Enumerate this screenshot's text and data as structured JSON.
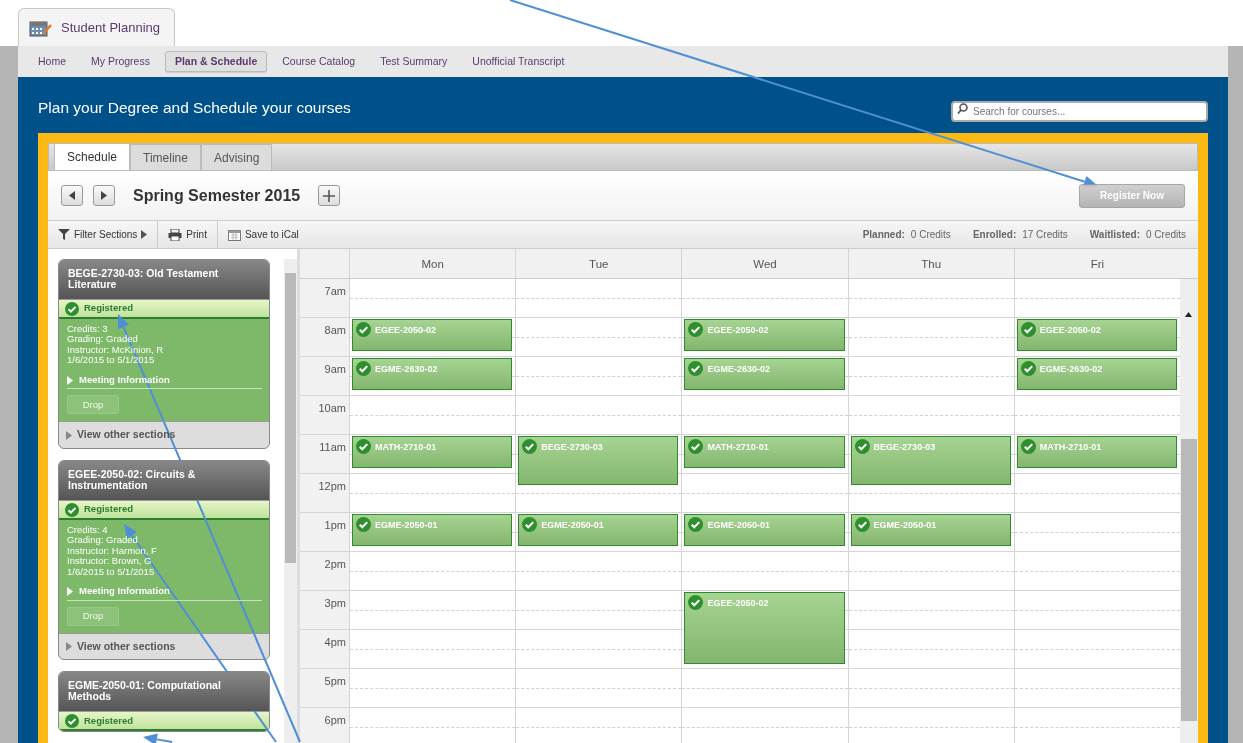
{
  "app_tab": {
    "label": "Student Planning"
  },
  "nav": [
    {
      "label": "Home",
      "selected": false
    },
    {
      "label": "My Progress",
      "selected": false
    },
    {
      "label": "Plan & Schedule",
      "selected": true
    },
    {
      "label": "Course Catalog",
      "selected": false
    },
    {
      "label": "Test Summary",
      "selected": false
    },
    {
      "label": "Unofficial Transcript",
      "selected": false
    }
  ],
  "header": {
    "title": "Plan your Degree and Schedule your courses",
    "search": {
      "placeholder": "Search for courses..."
    }
  },
  "view_tabs": [
    {
      "label": "Schedule",
      "selected": true
    },
    {
      "label": "Timeline",
      "selected": false
    },
    {
      "label": "Advising",
      "selected": false
    }
  ],
  "term": {
    "title": "Spring Semester 2015",
    "register_button": {
      "label": "Register Now",
      "disabled": true
    }
  },
  "toolbar": {
    "filter": "Filter Sections",
    "print": "Print",
    "ical": "Save to iCal"
  },
  "credits": [
    {
      "label": "Planned:",
      "value": "0 Credits"
    },
    {
      "label": "Enrolled:",
      "value": "17 Credits"
    },
    {
      "label": "Waitlisted:",
      "value": "0 Credits"
    }
  ],
  "sections": [
    {
      "title": "BEGE-2730-03: Old Testament Literature",
      "status": "Registered",
      "details": [
        "Credits: 3",
        "Grading: Graded",
        "Instructor: McKinion, R",
        "1/6/2015 to 5/1/2015"
      ],
      "meeting": "Meeting Information",
      "drop": {
        "label": "Drop",
        "disabled": true
      },
      "other": "View other sections"
    },
    {
      "title": "EGEE-2050-02: Circuits & Instrumentation",
      "status": "Registered",
      "details": [
        "Credits: 4",
        "Grading: Graded",
        "Instructor: Harmon, F",
        "Instructor: Brown, G",
        "1/6/2015 to 5/1/2015"
      ],
      "meeting": "Meeting Information",
      "drop": {
        "label": "Drop",
        "disabled": true
      },
      "other": "View other sections"
    },
    {
      "title": "EGME-2050-01: Computational Methods",
      "status": "Registered"
    }
  ],
  "calendar": {
    "days": [
      "Mon",
      "Tue",
      "Wed",
      "Thu",
      "Fri"
    ],
    "rows": [
      {
        "time": "7am",
        "cells": [
          null,
          null,
          null,
          null,
          null
        ]
      },
      {
        "time": "8am",
        "cells": [
          {
            "code": "EGEE-2050-02",
            "kind": "short",
            "registered": true
          },
          null,
          {
            "code": "EGEE-2050-02",
            "kind": "short",
            "registered": true
          },
          null,
          {
            "code": "EGEE-2050-02",
            "kind": "short",
            "registered": true
          }
        ]
      },
      {
        "time": "9am",
        "cells": [
          {
            "code": "EGME-2630-02",
            "kind": "short",
            "registered": true
          },
          null,
          {
            "code": "EGME-2630-02",
            "kind": "short",
            "registered": true
          },
          null,
          {
            "code": "EGME-2630-02",
            "kind": "short",
            "registered": true
          }
        ]
      },
      {
        "time": "10am",
        "cells": [
          null,
          null,
          null,
          null,
          null
        ]
      },
      {
        "time": "11am",
        "cells": [
          {
            "code": "MATH-2710-01",
            "kind": "short",
            "registered": true
          },
          {
            "code": "BEGE-2730-03",
            "kind": "medium",
            "registered": true
          },
          {
            "code": "MATH-2710-01",
            "kind": "short",
            "registered": true
          },
          {
            "code": "BEGE-2730-03",
            "kind": "medium",
            "registered": true
          },
          {
            "code": "MATH-2710-01",
            "kind": "short",
            "registered": true
          }
        ]
      },
      {
        "time": "12pm",
        "cells": [
          null,
          null,
          null,
          null,
          null
        ]
      },
      {
        "time": "1pm",
        "cells": [
          {
            "code": "EGME-2050-01",
            "kind": "short",
            "registered": true
          },
          {
            "code": "EGME-2050-01",
            "kind": "short",
            "registered": true
          },
          {
            "code": "EGME-2050-01",
            "kind": "short",
            "registered": true
          },
          {
            "code": "EGME-2050-01",
            "kind": "short",
            "registered": true
          },
          null
        ]
      },
      {
        "time": "2pm",
        "cells": [
          null,
          null,
          null,
          null,
          null
        ]
      },
      {
        "time": "3pm",
        "cells": [
          null,
          null,
          {
            "code": "EGEE-2050-02",
            "kind": "long",
            "registered": true
          },
          null,
          null
        ]
      },
      {
        "time": "4pm",
        "cells": [
          null,
          null,
          null,
          null,
          null
        ]
      },
      {
        "time": "5pm",
        "cells": [
          null,
          null,
          null,
          null,
          null
        ]
      },
      {
        "time": "6pm",
        "cells": [
          null,
          null,
          null,
          null,
          null
        ]
      }
    ]
  }
}
